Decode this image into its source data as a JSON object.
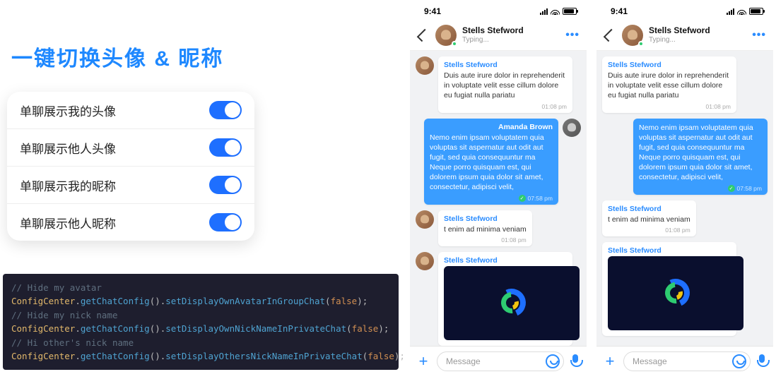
{
  "headline": "一键切换头像 & 昵称",
  "settings": [
    {
      "label": "单聊展示我的头像",
      "on": true
    },
    {
      "label": "单聊展示他人头像",
      "on": true
    },
    {
      "label": "单聊展示我的昵称",
      "on": true
    },
    {
      "label": "单聊展示他人昵称",
      "on": true
    }
  ],
  "code": {
    "lines": [
      {
        "comment": "// Hide my avatar"
      },
      {
        "cls": "ConfigCenter",
        "chain": ".getChatConfig().",
        "mth": "setDisplayOwnAvatarInGroupChat",
        "arg": "false"
      },
      {
        "comment": "// Hide my nick name"
      },
      {
        "cls": "ConfigCenter",
        "chain": ".getChatConfig().",
        "mth": "setDisplayOwnNickNameInPrivateChat",
        "arg": "false"
      },
      {
        "comment": "// Hi other's nick name"
      },
      {
        "cls": "ConfigCenter",
        "chain": ".getChatConfig().",
        "mth": "setDisplayOthersNickNameInPrivateChat",
        "arg": "false"
      }
    ]
  },
  "status_time": "9:41",
  "header": {
    "name": "Stells Stefword",
    "sub": "Typing..."
  },
  "messages": {
    "in1_sender": "Stells Stefword",
    "in1_text": "Duis aute irure dolor in reprehenderit in voluptate velit esse cillum dolore eu fugiat nulla pariatu",
    "in1_time": "01:08 pm",
    "out1_sender": "Amanda Brown",
    "out1_text": "Nemo enim ipsam voluptatem quia voluptas sit aspernatur aut odit aut fugit, sed quia consequuntur ma Neque porro quisquam est, qui dolorem ipsum quia dolor sit amet, consectetur, adipisci velit,",
    "out1_time": "07:58 pm",
    "in2_sender": "Stells Stefword",
    "in2_text": "t enim ad minima veniam",
    "in2_time": "01:08 pm",
    "in3_sender": "Stells Stefword"
  },
  "input_placeholder": "Message",
  "more_dots": "•••"
}
